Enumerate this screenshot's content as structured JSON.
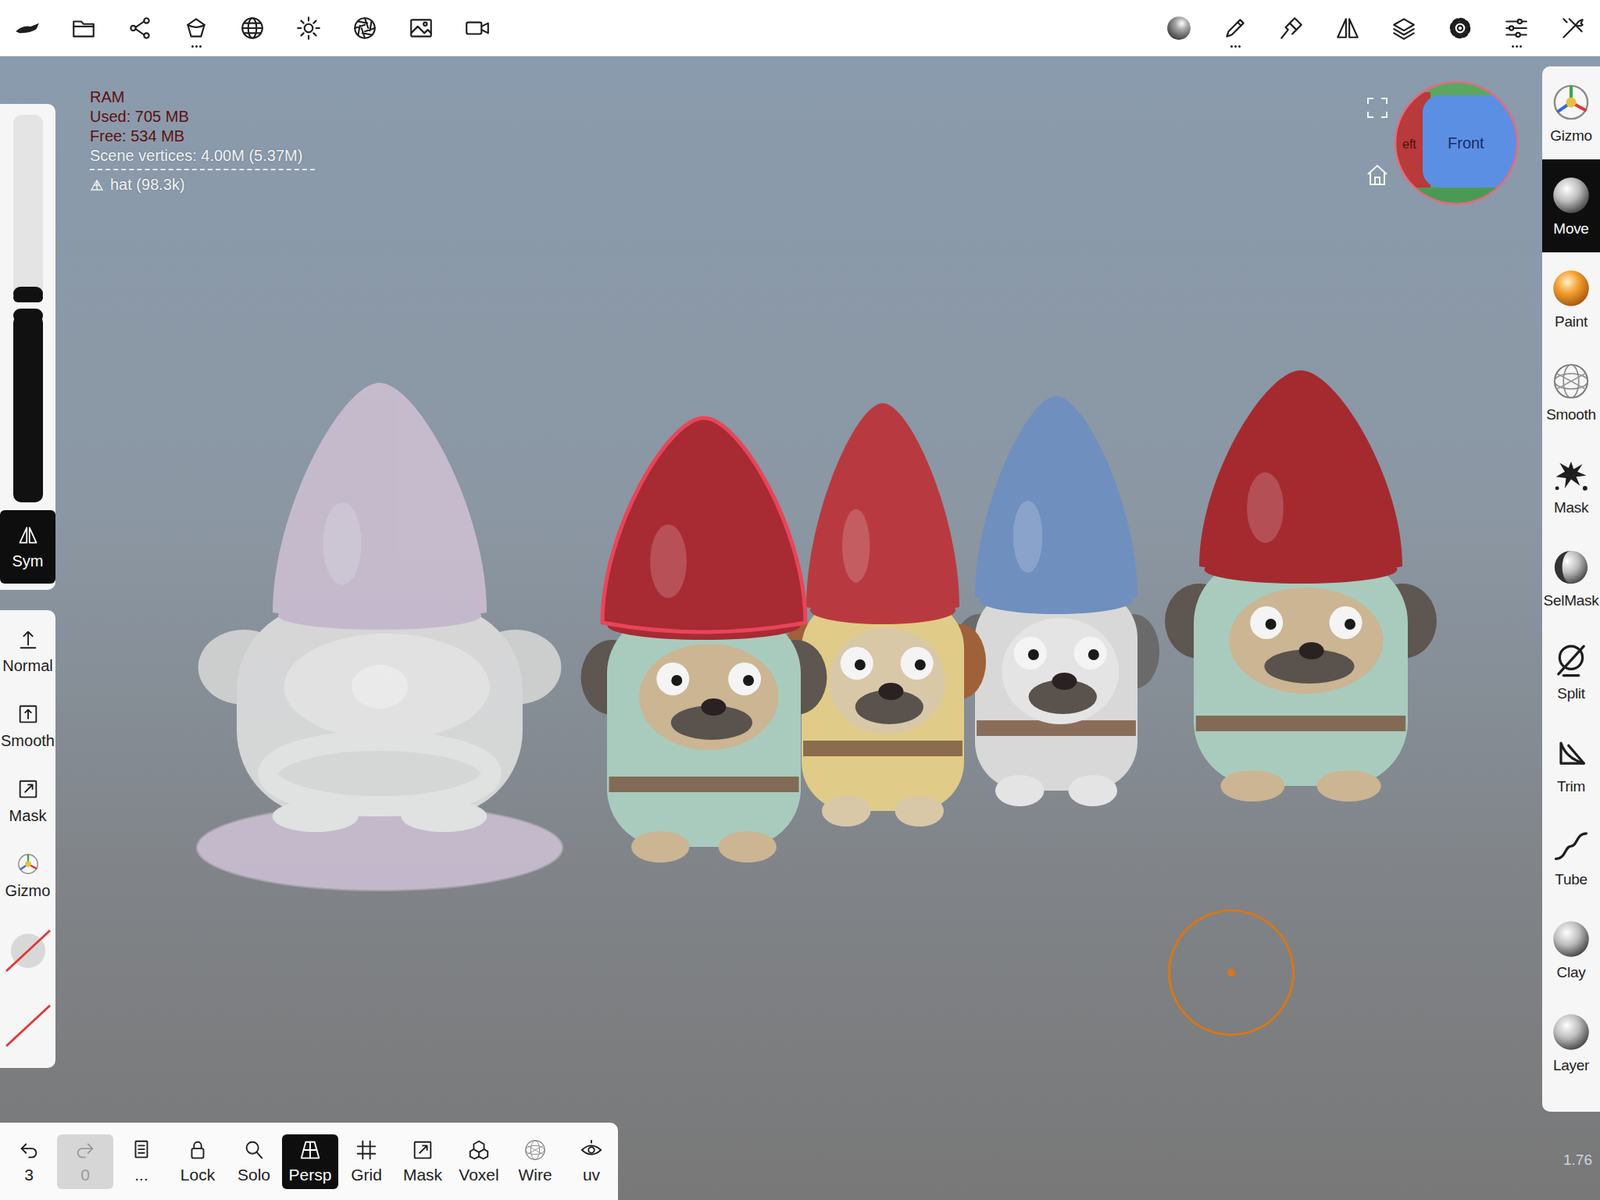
{
  "stats": {
    "title": "RAM",
    "used": "Used: 705 MB",
    "free": "Free: 534 MB",
    "vertices": "Scene vertices: 4.00M (5.37M)",
    "object": "hat (98.3k)"
  },
  "nav_cube": {
    "front": "Front",
    "left": "eft"
  },
  "sliders": [
    {
      "level": 0.05
    },
    {
      "level": 1
    }
  ],
  "sym": {
    "label": "Sym",
    "selected": true
  },
  "left_tools": [
    {
      "label": "Normal",
      "kind": "normal",
      "selected": false
    },
    {
      "label": "Smooth",
      "kind": "smooth",
      "selected": false
    },
    {
      "label": "Mask",
      "kind": "mask",
      "selected": false
    },
    {
      "label": "Gizmo",
      "kind": "gizmo",
      "selected": false
    }
  ],
  "right_tools": [
    {
      "label": "Gizmo",
      "kind": "gizmo",
      "selected": false
    },
    {
      "label": "Move",
      "kind": "sphere",
      "selected": true
    },
    {
      "label": "Paint",
      "kind": "paint",
      "selected": false
    },
    {
      "label": "Smooth",
      "kind": "wire",
      "selected": false
    },
    {
      "label": "Mask",
      "kind": "splat",
      "selected": false
    },
    {
      "label": "SelMask",
      "kind": "selmask",
      "selected": false
    },
    {
      "label": "Split",
      "kind": "split",
      "selected": false
    },
    {
      "label": "Trim",
      "kind": "trim",
      "selected": false
    },
    {
      "label": "Tube",
      "kind": "tube",
      "selected": false
    },
    {
      "label": "Clay",
      "kind": "sphere",
      "selected": false
    },
    {
      "label": "Layer",
      "kind": "sphere",
      "selected": false
    }
  ],
  "bottom_toolbar": [
    {
      "label": "3",
      "kind": "undo",
      "selected": false,
      "disabled": false
    },
    {
      "label": "0",
      "kind": "redo",
      "selected": false,
      "disabled": true
    },
    {
      "label": "...",
      "kind": "notes",
      "selected": false,
      "disabled": false
    },
    {
      "label": "Lock",
      "kind": "lock",
      "selected": false,
      "disabled": false
    },
    {
      "label": "Solo",
      "kind": "solo",
      "selected": false,
      "disabled": false
    },
    {
      "label": "Persp",
      "kind": "persp",
      "selected": true,
      "disabled": false
    },
    {
      "label": "Grid",
      "kind": "grid",
      "selected": false,
      "disabled": false
    },
    {
      "label": "Mask",
      "kind": "mask",
      "selected": false,
      "disabled": false
    },
    {
      "label": "Voxel",
      "kind": "voxel",
      "selected": false,
      "disabled": false
    },
    {
      "label": "Wire",
      "kind": "wire",
      "selected": false,
      "disabled": false
    },
    {
      "label": "uv",
      "kind": "uv",
      "selected": false,
      "disabled": false
    }
  ],
  "zoom": "1.76",
  "scene": {
    "objects": [
      {
        "kind": "statue",
        "hat_color": "#c9bdd0",
        "body_color": "#dcdcdc",
        "face_color": "#e8e8e8",
        "ear_color": "#d2d2d2",
        "selected": false
      },
      {
        "kind": "gnome",
        "hat_color": "#a82a32",
        "body_color": "#a9cbbd",
        "face_color": "#cbb592",
        "ear_color": "#5e5650",
        "selected": true
      },
      {
        "kind": "gnome",
        "hat_color": "#b83a40",
        "body_color": "#e0cc88",
        "face_color": "#d8c8a8",
        "ear_color": "#a0603a",
        "selected": false
      },
      {
        "kind": "gnome",
        "hat_color": "#6f8fbf",
        "body_color": "#d8d8d8",
        "face_color": "#e4e4e4",
        "ear_color": "#6a6a6a",
        "selected": false
      },
      {
        "kind": "gnome",
        "hat_color": "#a42a30",
        "body_color": "#a9cbbd",
        "face_color": "#cbb592",
        "ear_color": "#5e5650",
        "selected": false
      }
    ]
  }
}
